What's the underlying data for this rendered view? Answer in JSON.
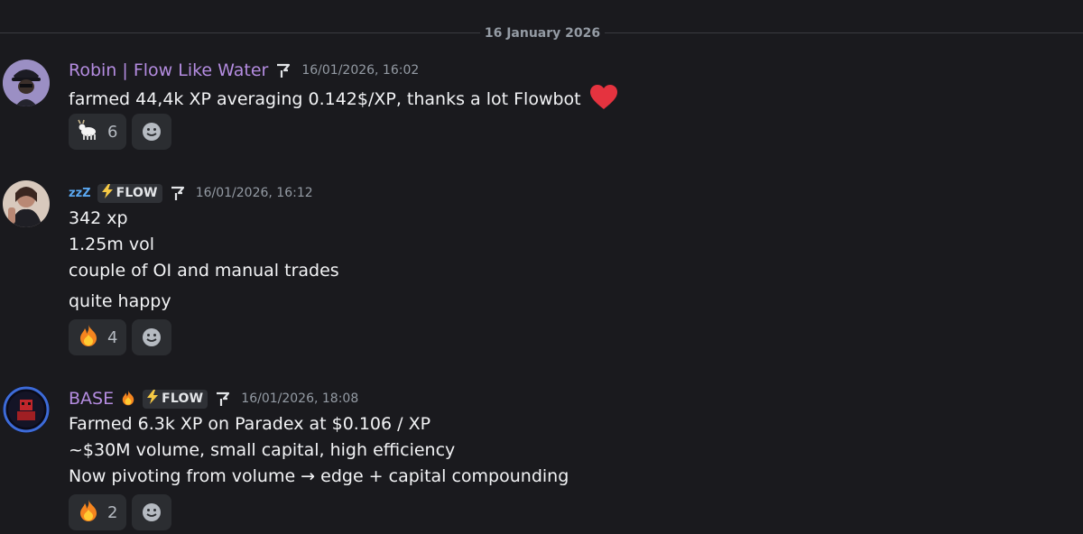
{
  "date_divider": "16 January 2026",
  "messages": [
    {
      "author": "Robin | Flow Like Water",
      "timestamp": "16/01/2026, 16:02",
      "lines": [
        "farmed 44,4k XP averaging 0.142$/XP, thanks a lot Flowbot"
      ],
      "reactions": [
        {
          "emoji": "goat-emoji",
          "count": "6"
        }
      ]
    },
    {
      "author_prefix": "zzZ",
      "tag": "FLOW",
      "timestamp": "16/01/2026, 16:12",
      "lines": [
        "342 xp",
        "1.25m vol",
        "couple of OI and manual trades",
        "quite happy"
      ],
      "reactions": [
        {
          "emoji": "fire-emoji",
          "count": "4"
        }
      ]
    },
    {
      "author": "BASE",
      "tag": "FLOW",
      "timestamp": "16/01/2026, 18:08",
      "lines": [
        "Farmed 6.3k XP on Paradex at $0.106 / XP",
        "~$30M volume, small capital, high efficiency",
        "Now pivoting from volume → edge + capital compounding"
      ],
      "reactions": [
        {
          "emoji": "fire-emoji",
          "count": "2"
        }
      ]
    }
  ],
  "colors": {
    "background": "#1a1a1e",
    "username": "#b48ce0",
    "text": "#f2f3f5",
    "muted": "#949ba4",
    "reaction_bg": "#2b2d31",
    "heart": "#e5333f",
    "zzz": "#5aa7f0"
  }
}
